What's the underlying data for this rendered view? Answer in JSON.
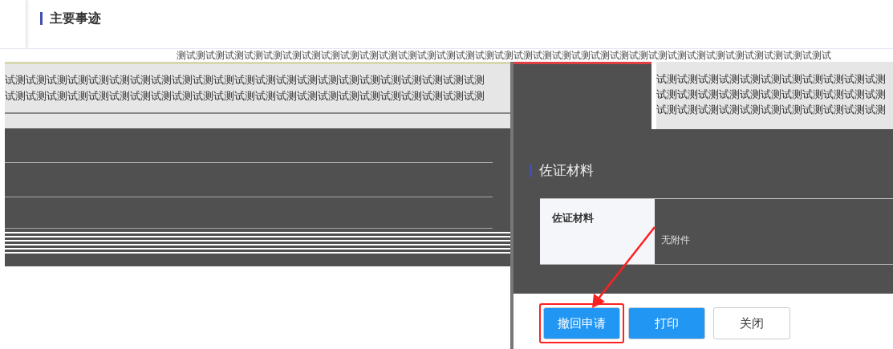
{
  "section_title": "主要事迹",
  "main_facts": {
    "top_line": "测试测试测试测试测试测试测试测试测试测试测试测试测试测试测试测试测试测试测试测试测试测试测试测试测试测试测试测试测试测试测试测试测试测试",
    "left_lines": [
      "试测试测试测试测试测试测试测试测试测试测试测试测试测试测试测试测试测试测试测试测试测试测试测",
      "试测试测试测试测试测试测试测试测试测试测试测试测试测试测试测试测试测试测试测试测试测试测试测"
    ],
    "right_lines": [
      "试测试测试测试测试测试测试测试测试测试测试测",
      "试测试测试测试测试测试测试测试测试测试测试测",
      "试测试测试测试测试测试测试测试测试测试测试测"
    ]
  },
  "evidence": {
    "title": "佐证材料",
    "label": "佐证材料",
    "value": "无附件"
  },
  "buttons": [
    {
      "label": "撤回申请",
      "kind": "primary",
      "highlighted": true
    },
    {
      "label": "打印",
      "kind": "primary",
      "highlighted": false
    },
    {
      "label": "关闭",
      "kind": "default",
      "highlighted": false
    }
  ]
}
